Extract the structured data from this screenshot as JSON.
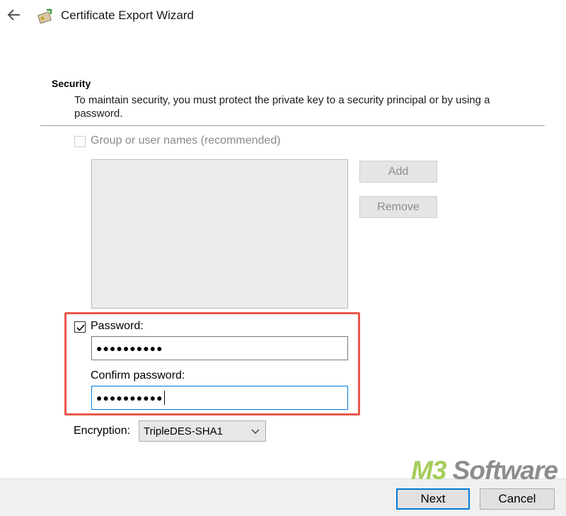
{
  "window": {
    "title": "Certificate Export Wizard"
  },
  "security": {
    "heading": "Security",
    "description": "To maintain security, you must protect the private key to a security principal or by using a password.",
    "group_checkbox": {
      "label": "Group or user names (recommended)",
      "checked": false,
      "enabled": false
    },
    "add_label": "Add",
    "remove_label": "Remove",
    "password_checkbox": {
      "label": "Password:",
      "checked": true
    },
    "password_value": "●●●●●●●●●●",
    "confirm_label": "Confirm password:",
    "confirm_value": "●●●●●●●●●●",
    "encryption_label": "Encryption:",
    "encryption_value": "TripleDES-SHA1"
  },
  "footer": {
    "next_label": "Next",
    "cancel_label": "Cancel"
  },
  "watermark": {
    "brand": "M3",
    "rest": " Software"
  },
  "colors": {
    "highlight": "#e8574c",
    "focus": "#0078d7",
    "watermark_green": "#a4cc5a"
  },
  "icons": [
    "back-arrow-icon",
    "certificate-icon",
    "checkmark-icon",
    "chevron-down-icon"
  ]
}
